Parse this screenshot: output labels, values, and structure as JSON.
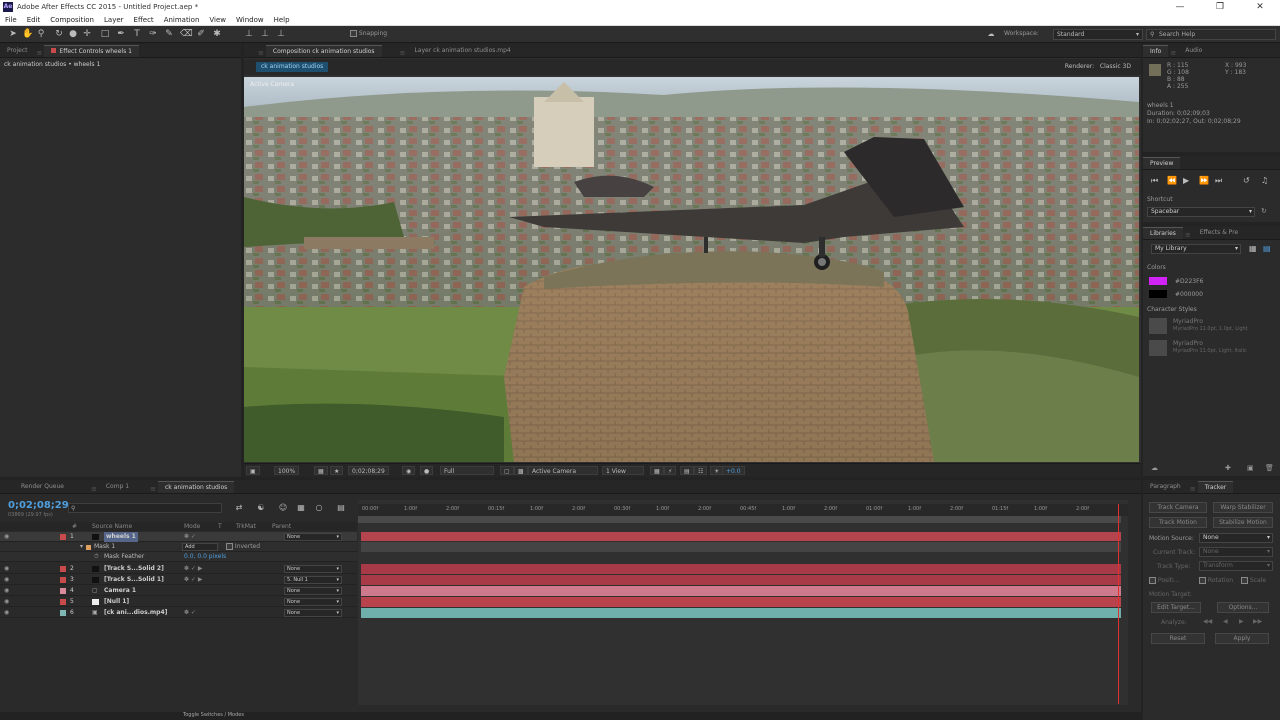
{
  "window": {
    "title": "Adobe After Effects CC 2015 - Untitled Project.aep *",
    "app_icon": "Ae"
  },
  "menu": [
    "File",
    "Edit",
    "Composition",
    "Layer",
    "Effect",
    "Animation",
    "View",
    "Window",
    "Help"
  ],
  "toolbar": {
    "snapping_label": "Snapping",
    "workspace_label": "Workspace:",
    "workspace_value": "Standard",
    "search_placeholder": "Search Help"
  },
  "left_panel": {
    "tabs": [
      "Project",
      "Effect Controls wheels 1"
    ],
    "header": "ck animation studios • wheels 1"
  },
  "comp_panel": {
    "tabs": [
      "Composition ck animation studios",
      "Layer ck animation studios.mp4"
    ],
    "crumb": "ck animation studios",
    "renderer_label": "Renderer:",
    "renderer_value": "Classic 3D",
    "camera_label": "Active Camera",
    "bottom": {
      "zoom": "100%",
      "timecode": "0;02;08;29",
      "resolution": "Full",
      "view": "Active Camera",
      "views": "1 View",
      "exposure": "+0.0"
    }
  },
  "info_panel": {
    "tabs": [
      "Info",
      "Audio"
    ],
    "r": "R : 115",
    "g": "G : 108",
    "b": "B : 88",
    "a": "A : 255",
    "x": "X : 993",
    "y": "Y : 183",
    "layer_name": "wheels 1",
    "duration": "Duration: 0;02;09;03",
    "in_out": "In: 0;02;02;27, Out: 0;02;08;29"
  },
  "preview_panel": {
    "title": "Preview",
    "shortcut_label": "Shortcut",
    "shortcut_value": "Spacebar"
  },
  "libraries_panel": {
    "tabs": [
      "Libraries",
      "Effects & Pre"
    ],
    "library": "My Library",
    "colors_label": "Colors",
    "colors": [
      {
        "hex": "#D223F6",
        "label": "#D223F6"
      },
      {
        "hex": "#000000",
        "label": "#000000"
      }
    ],
    "char_styles_label": "Character Styles",
    "char_styles": [
      {
        "name": "MyriadPro",
        "desc": "MyriadPro 11.0pt, 1.0pt, Light"
      },
      {
        "name": "MyriadPro",
        "desc": "MyriadPro 11.0pt, Light, Italic"
      }
    ]
  },
  "tracker_panel": {
    "tabs": [
      "Paragraph",
      "Tracker"
    ],
    "buttons": [
      "Track Camera",
      "Warp Stabilizer",
      "Track Motion",
      "Stabilize Motion"
    ],
    "motion_source_label": "Motion Source:",
    "motion_source": "None",
    "current_track_label": "Current Track:",
    "current_track": "None",
    "track_type_label": "Track Type:",
    "track_type": "Transform",
    "checks": [
      "Positi...",
      "Rotation",
      "Scale"
    ],
    "motion_target_label": "Motion Target:",
    "edit_target": "Edit Target...",
    "options": "Options...",
    "analyze": "Analyze:",
    "reset": "Reset",
    "apply": "Apply"
  },
  "timeline": {
    "tabs": [
      "Render Queue",
      "Comp 1",
      "ck animation studios"
    ],
    "timecode": "0;02;08;29",
    "fps": "03869 (29.97 fps)",
    "columns": [
      "#",
      "Source Name",
      "Mode",
      "T",
      "TrkMat",
      "Parent"
    ],
    "sub_rows": [
      {
        "label": "Mask 1",
        "mode": "Add",
        "extra": "Inverted"
      },
      {
        "label": "Mask Feather",
        "value": "0.0, 0.0 pixels"
      }
    ],
    "layers": [
      {
        "num": "1",
        "name": "wheels 1",
        "color": "#c94a4a",
        "parent": "None",
        "bar": "#b4454f"
      },
      {
        "num": "2",
        "name": "[Track S...Solid 2]",
        "color": "#c94a4a",
        "parent": "None",
        "bar": "#a83a48"
      },
      {
        "num": "3",
        "name": "[Track S...Solid 1]",
        "color": "#c94a4a",
        "parent": "5. Null 1",
        "bar": "#a83a48"
      },
      {
        "num": "4",
        "name": "Camera 1",
        "color": "#d98a9a",
        "parent": "None",
        "bar": "#cf7a8c"
      },
      {
        "num": "5",
        "name": "[Null 1]",
        "color": "#c94a4a",
        "parent": "None",
        "bar": "#b8434c"
      },
      {
        "num": "6",
        "name": "[ck ani...dios.mp4]",
        "color": "#7fb7b4",
        "parent": "None",
        "bar": "#6fb0ac"
      }
    ],
    "ruler": [
      "00:00f",
      "1:00f",
      "2:00f",
      "00:15f",
      "1:00f",
      "2:00f",
      "00:30f",
      "1:00f",
      "2:00f",
      "00:45f",
      "1:00f",
      "2:00f",
      "01:00f",
      "1:00f",
      "2:00f",
      "01:15f",
      "1:00f",
      "2:00f"
    ],
    "status": "Toggle Switches / Modes"
  }
}
